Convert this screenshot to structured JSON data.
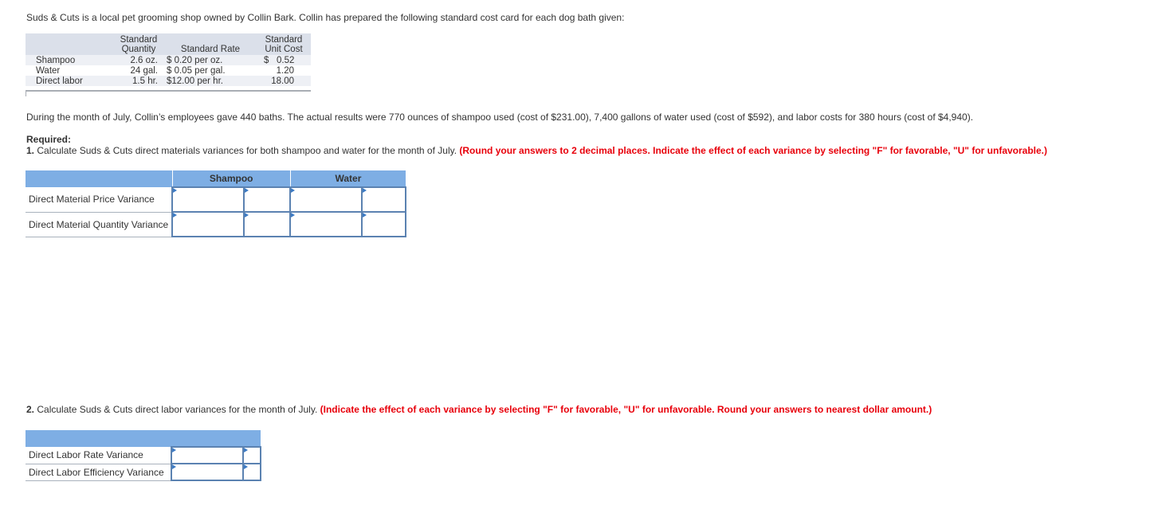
{
  "intro": "Suds & Cuts is a local pet grooming shop owned by Collin Bark. Collin has prepared the following standard cost card for each dog bath given:",
  "cost_card": {
    "headers": {
      "quantity": [
        "Standard",
        "Quantity"
      ],
      "rate": "Standard Rate",
      "unit_cost": [
        "Standard",
        "Unit Cost"
      ]
    },
    "rows": [
      {
        "item": "Shampoo",
        "quantity": "2.6 oz.",
        "rate": "$ 0.20 per oz.",
        "unit_cost": "$   0.52"
      },
      {
        "item": "Water",
        "quantity": "24 gal.",
        "rate": "$ 0.05 per gal.",
        "unit_cost": "1.20"
      },
      {
        "item": "Direct labor",
        "quantity": "1.5 hr.",
        "rate": "$12.00 per hr.",
        "unit_cost": "18.00"
      }
    ]
  },
  "actuals_paragraph": "During the month of July, Collin’s employees gave 440 baths. The actual results were 770 ounces of shampoo used (cost of $231.00), 7,400 gallons of water used (cost of $592), and labor costs for 380 hours (cost of $4,940).",
  "required_title": "Required:",
  "req1": {
    "number": "1.",
    "text": " Calculate Suds & Cuts direct materials variances for both shampoo and water for the month of July. ",
    "instruction": "(Round your answers to 2 decimal places. Indicate the effect of each variance by selecting \"F\" for favorable, \"U\" for unfavorable.)"
  },
  "materials_table": {
    "columns": [
      "Shampoo",
      "Water"
    ],
    "rows": [
      {
        "label": "Direct Material Price Variance",
        "shampoo_amount": "",
        "shampoo_effect": "",
        "water_amount": "",
        "water_effect": ""
      },
      {
        "label": "Direct Material Quantity Variance",
        "shampoo_amount": "",
        "shampoo_effect": "",
        "water_amount": "",
        "water_effect": ""
      }
    ]
  },
  "req2": {
    "number": "2.",
    "text": " Calculate Suds & Cuts direct labor variances for the month of July. ",
    "instruction": "(Indicate the effect of each variance by selecting \"F\" for favorable, \"U\" for unfavorable. Round your answers to nearest dollar amount.)"
  },
  "labor_table": {
    "rows": [
      {
        "label": "Direct Labor Rate Variance",
        "amount": "",
        "effect": ""
      },
      {
        "label": "Direct Labor Efficiency Variance",
        "amount": "",
        "effect": ""
      }
    ]
  }
}
